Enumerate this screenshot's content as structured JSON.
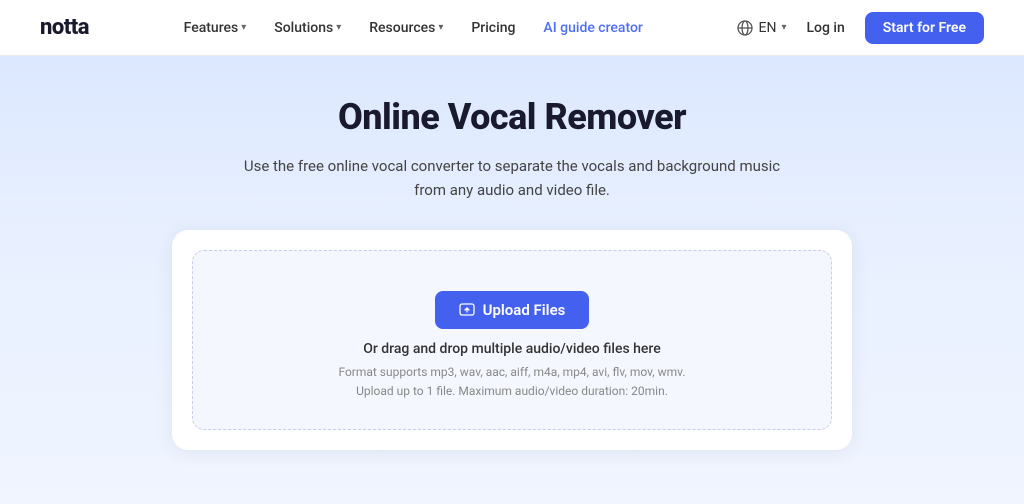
{
  "nav": {
    "logo": "notta",
    "links": [
      {
        "label": "Features",
        "hasChevron": true,
        "href": "#"
      },
      {
        "label": "Solutions",
        "hasChevron": true,
        "href": "#"
      },
      {
        "label": "Resources",
        "hasChevron": true,
        "href": "#"
      },
      {
        "label": "Pricing",
        "hasChevron": false,
        "href": "#"
      },
      {
        "label": "AI guide creator",
        "hasChevron": false,
        "href": "#",
        "highlight": true
      }
    ],
    "language_label": "EN",
    "login_label": "Log in",
    "start_free_label": "Start for Free"
  },
  "hero": {
    "title": "Online Vocal Remover",
    "subtitle": "Use the free online vocal converter to separate the vocals and background music from any audio and video file."
  },
  "upload": {
    "button_label": "Upload Files",
    "drag_drop_text": "Or drag and drop multiple audio/video files here",
    "format_line1": "Format supports mp3, wav, aac, aiff, m4a, mp4, avi, flv, mov, wmv.",
    "format_line2": "Upload up to 1 file. Maximum audio/video duration: 20min."
  }
}
